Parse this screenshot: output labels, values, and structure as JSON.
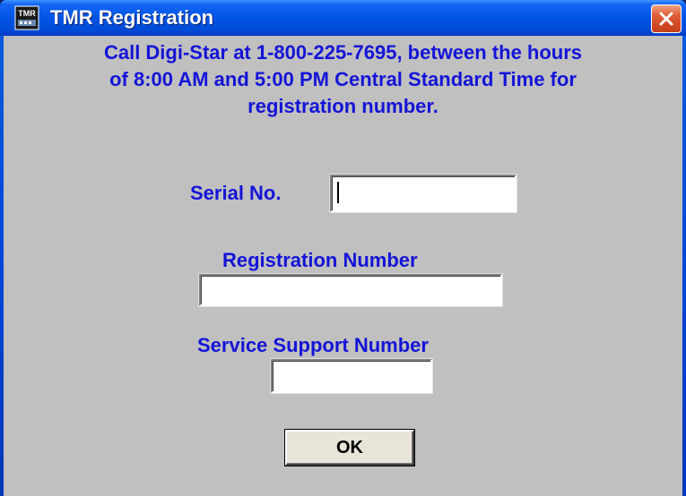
{
  "window": {
    "title": "TMR Registration",
    "icon": "tmr-app-icon",
    "icon_text": "TMR"
  },
  "instructions": {
    "line1": "Call Digi-Star at 1-800-225-7695, between the hours",
    "line2": "of 8:00 AM and 5:00 PM Central Standard Time for",
    "line3": "registration number."
  },
  "fields": {
    "serial": {
      "label": "Serial No.",
      "value": ""
    },
    "registration": {
      "label": "Registration Number",
      "value": ""
    },
    "service": {
      "label": "Service Support Number",
      "value": ""
    }
  },
  "buttons": {
    "ok_label": "OK",
    "close_icon": "close-icon"
  },
  "colors": {
    "title_bar": "#0055e5",
    "client_bg": "#c0c0c0",
    "label_text": "#1414d8",
    "close_button": "#d24a24"
  }
}
